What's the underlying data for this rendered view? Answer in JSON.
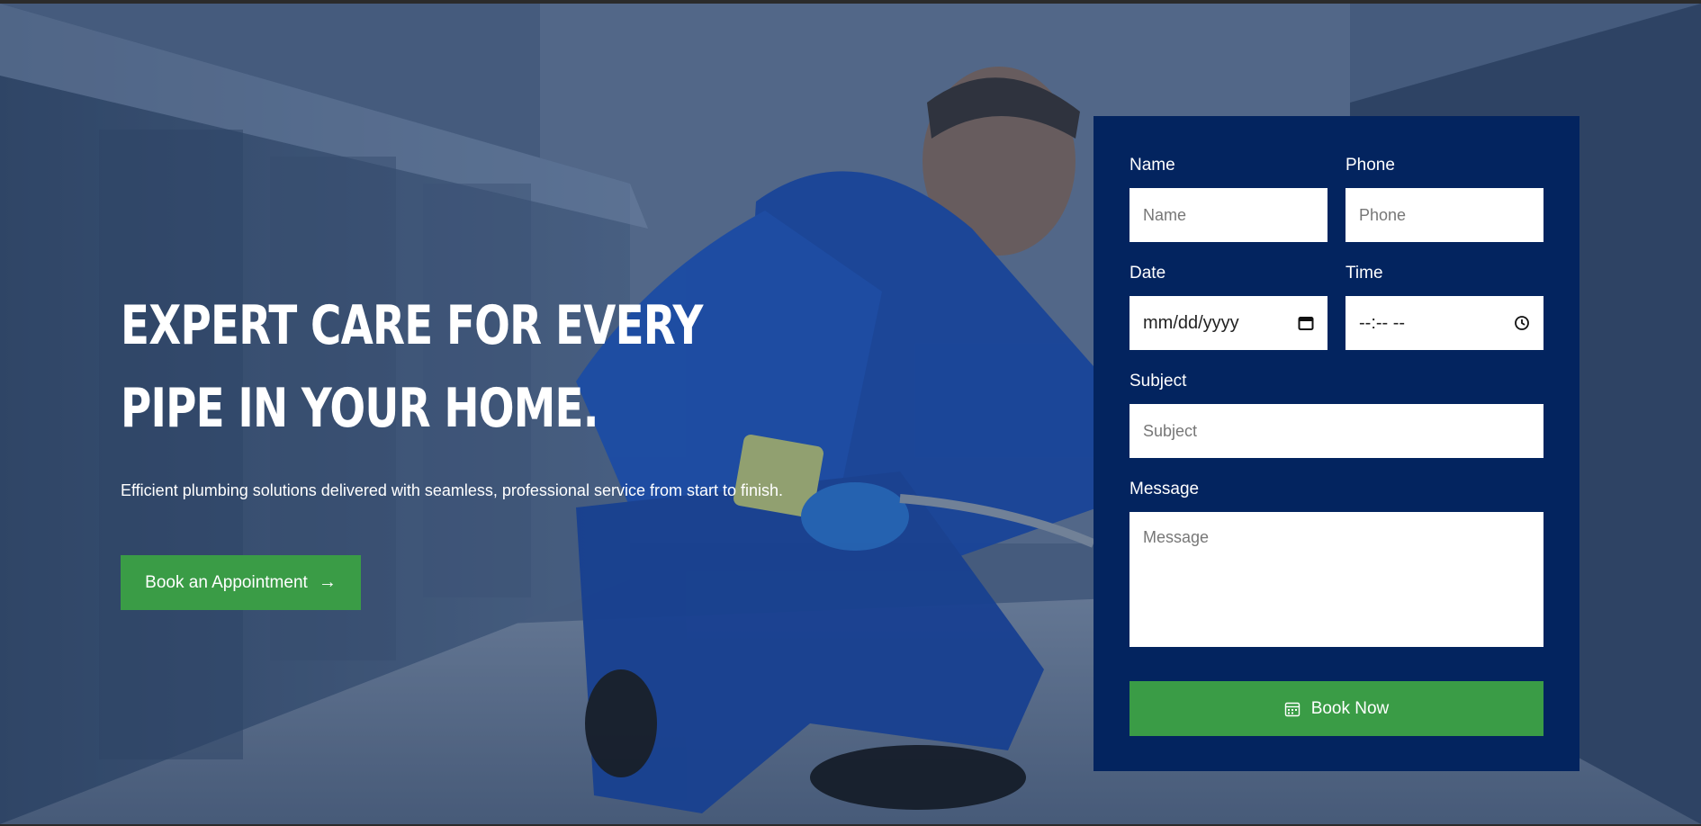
{
  "hero": {
    "headline_line1": "EXPERT CARE FOR EVERY",
    "headline_line2": "PIPE IN YOUR HOME.",
    "subtext": "Efficient plumbing solutions delivered with seamless, professional service from start to finish.",
    "cta_label": "Book an Appointment",
    "cta_icon": "arrow-right-icon"
  },
  "form": {
    "name": {
      "label": "Name",
      "placeholder": "Name"
    },
    "phone": {
      "label": "Phone",
      "placeholder": "Phone"
    },
    "date": {
      "label": "Date",
      "value": "mm/dd/yyyy",
      "icon": "calendar-icon"
    },
    "time": {
      "label": "Time",
      "value": "--:-- --",
      "icon": "clock-icon"
    },
    "subject": {
      "label": "Subject",
      "placeholder": "Subject"
    },
    "message": {
      "label": "Message",
      "placeholder": "Message"
    },
    "submit_label": "Book Now",
    "submit_icon": "calendar-icon"
  },
  "colors": {
    "panel": "#03245f",
    "accent_green": "#3a9c46",
    "overlay_blue": "#2f4260"
  }
}
